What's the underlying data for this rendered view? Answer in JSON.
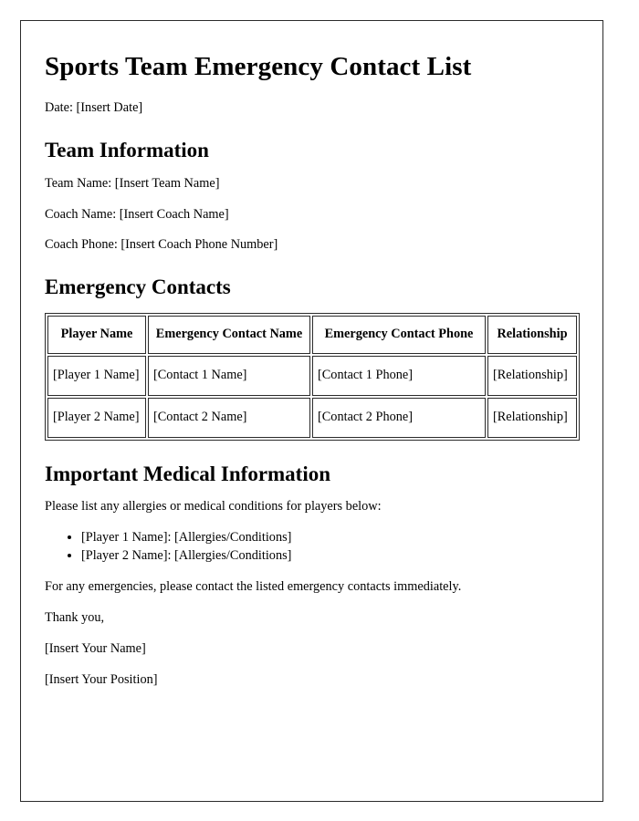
{
  "document": {
    "title": "Sports Team Emergency Contact List",
    "date_line": "Date: [Insert Date]"
  },
  "team_information": {
    "heading": "Team Information",
    "team_name_line": "Team Name: [Insert Team Name]",
    "coach_name_line": "Coach Name: [Insert Coach Name]",
    "coach_phone_line": "Coach Phone: [Insert Coach Phone Number]"
  },
  "emergency_contacts": {
    "heading": "Emergency Contacts",
    "columns": [
      "Player Name",
      "Emergency Contact Name",
      "Emergency Contact Phone",
      "Relationship"
    ],
    "rows": [
      {
        "player_name": "[Player 1 Name]",
        "contact_name": "[Contact 1 Name]",
        "contact_phone": "[Contact 1 Phone]",
        "relationship": "[Relationship]"
      },
      {
        "player_name": "[Player 2 Name]",
        "contact_name": "[Contact 2 Name]",
        "contact_phone": "[Contact 2 Phone]",
        "relationship": "[Relationship]"
      }
    ]
  },
  "medical_information": {
    "heading": "Important Medical Information",
    "intro": "Please list any allergies or medical conditions for players below:",
    "items": [
      "[Player 1 Name]: [Allergies/Conditions]",
      "[Player 2 Name]: [Allergies/Conditions]"
    ]
  },
  "closing": {
    "emergency_note": "For any emergencies, please contact the listed emergency contacts immediately.",
    "thanks": "Thank you,",
    "your_name": "[Insert Your Name]",
    "your_position": "[Insert Your Position]"
  }
}
